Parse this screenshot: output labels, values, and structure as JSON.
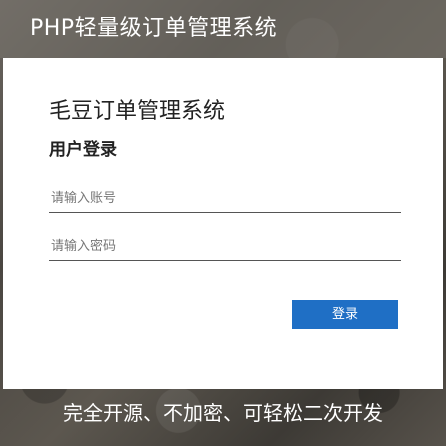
{
  "header": {
    "title": "PHP轻量级订单管理系统"
  },
  "login": {
    "brand": "毛豆订单管理系统",
    "heading": "用户登录",
    "account_placeholder": "请输入账号",
    "password_placeholder": "请输入密码",
    "submit_label": "登录"
  },
  "footer": {
    "slogan": "完全开源、不加密、可轻松二次开发"
  },
  "colors": {
    "primary_button": "#1f6fc5",
    "card_background": "#ffffff"
  }
}
